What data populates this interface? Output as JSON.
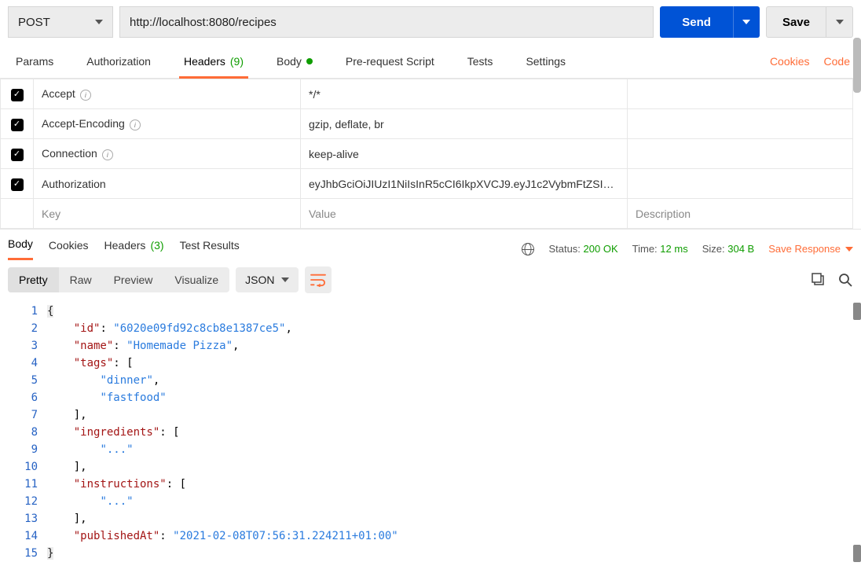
{
  "request": {
    "method": "POST",
    "url": "http://localhost:8080/recipes",
    "send_label": "Send",
    "save_label": "Save"
  },
  "req_tabs": {
    "params": "Params",
    "auth": "Authorization",
    "headers": "Headers",
    "headers_count": "(9)",
    "body": "Body",
    "prs": "Pre-request Script",
    "tests": "Tests",
    "settings": "Settings",
    "cookies": "Cookies",
    "code": "Code"
  },
  "headers": [
    {
      "key": "Accept",
      "value": "*/*",
      "info": true
    },
    {
      "key": "Accept-Encoding",
      "value": "gzip, deflate, br",
      "info": true
    },
    {
      "key": "Connection",
      "value": "keep-alive",
      "info": true
    },
    {
      "key": "Authorization",
      "value": "eyJhbGciOiJIUzI1NiIsInR5cCI6IkpXVCJ9.eyJ1c2VybmFtZSI6I...",
      "info": false
    }
  ],
  "header_placeholders": {
    "key": "Key",
    "value": "Value",
    "desc": "Description"
  },
  "resp_tabs": {
    "body": "Body",
    "cookies": "Cookies",
    "headers": "Headers",
    "headers_count": "(3)",
    "tests": "Test Results"
  },
  "resp_meta": {
    "status_label": "Status:",
    "status_value": "200 OK",
    "time_label": "Time:",
    "time_value": "12 ms",
    "size_label": "Size:",
    "size_value": "304 B",
    "save_response": "Save Response"
  },
  "view": {
    "pretty": "Pretty",
    "raw": "Raw",
    "preview": "Preview",
    "visualize": "Visualize",
    "format": "JSON"
  },
  "code_lines": [
    [
      {
        "t": "hl",
        "v": "{"
      }
    ],
    [
      {
        "t": "ind",
        "v": "    "
      },
      {
        "t": "key",
        "v": "\"id\""
      },
      {
        "t": "punc",
        "v": ": "
      },
      {
        "t": "str",
        "v": "\"6020e09fd92c8cb8e1387ce5\""
      },
      {
        "t": "punc",
        "v": ","
      }
    ],
    [
      {
        "t": "ind",
        "v": "    "
      },
      {
        "t": "key",
        "v": "\"name\""
      },
      {
        "t": "punc",
        "v": ": "
      },
      {
        "t": "str",
        "v": "\"Homemade Pizza\""
      },
      {
        "t": "punc",
        "v": ","
      }
    ],
    [
      {
        "t": "ind",
        "v": "    "
      },
      {
        "t": "key",
        "v": "\"tags\""
      },
      {
        "t": "punc",
        "v": ": ["
      }
    ],
    [
      {
        "t": "ind",
        "v": "        "
      },
      {
        "t": "str",
        "v": "\"dinner\""
      },
      {
        "t": "punc",
        "v": ","
      }
    ],
    [
      {
        "t": "ind",
        "v": "        "
      },
      {
        "t": "str",
        "v": "\"fastfood\""
      }
    ],
    [
      {
        "t": "ind",
        "v": "    "
      },
      {
        "t": "punc",
        "v": "],"
      }
    ],
    [
      {
        "t": "ind",
        "v": "    "
      },
      {
        "t": "key",
        "v": "\"ingredients\""
      },
      {
        "t": "punc",
        "v": ": ["
      }
    ],
    [
      {
        "t": "ind",
        "v": "        "
      },
      {
        "t": "str",
        "v": "\"...\""
      }
    ],
    [
      {
        "t": "ind",
        "v": "    "
      },
      {
        "t": "punc",
        "v": "],"
      }
    ],
    [
      {
        "t": "ind",
        "v": "    "
      },
      {
        "t": "key",
        "v": "\"instructions\""
      },
      {
        "t": "punc",
        "v": ": ["
      }
    ],
    [
      {
        "t": "ind",
        "v": "        "
      },
      {
        "t": "str",
        "v": "\"...\""
      }
    ],
    [
      {
        "t": "ind",
        "v": "    "
      },
      {
        "t": "punc",
        "v": "],"
      }
    ],
    [
      {
        "t": "ind",
        "v": "    "
      },
      {
        "t": "key",
        "v": "\"publishedAt\""
      },
      {
        "t": "punc",
        "v": ": "
      },
      {
        "t": "str",
        "v": "\"2021-02-08T07:56:31.224211+01:00\""
      }
    ],
    [
      {
        "t": "hl",
        "v": "}"
      }
    ]
  ]
}
